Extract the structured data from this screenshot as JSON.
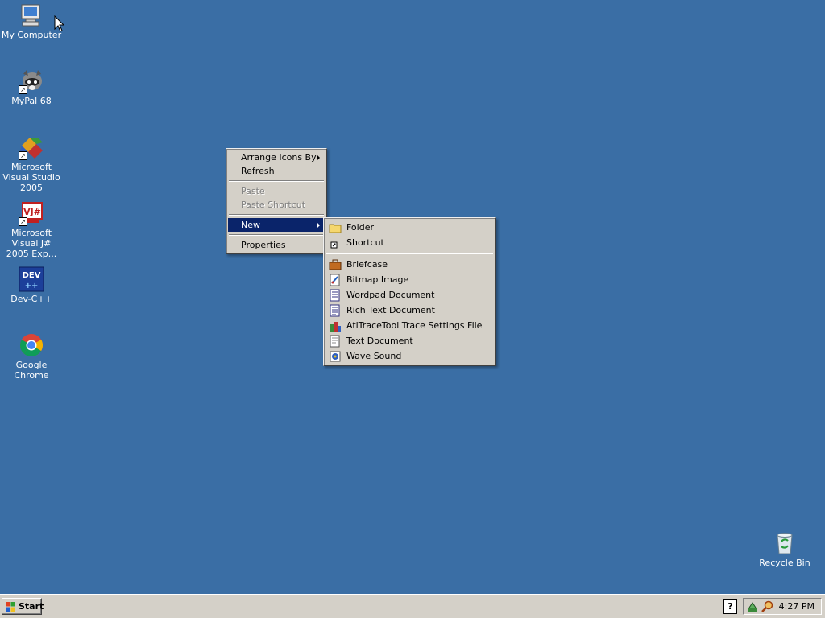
{
  "desktop": {
    "background_color": "#3a6ea5",
    "icons": [
      {
        "label": "My Computer",
        "icon": "computer-icon"
      },
      {
        "label": "MyPal 68",
        "icon": "raccoon-icon"
      },
      {
        "label": "Microsoft Visual Studio 2005",
        "icon": "visual-studio-icon"
      },
      {
        "label": "Microsoft Visual J# 2005 Exp...",
        "icon": "vjsharp-icon"
      },
      {
        "label": "Dev-C++",
        "icon": "devcpp-icon"
      },
      {
        "label": "Google Chrome",
        "icon": "chrome-icon"
      },
      {
        "label": "Recycle Bin",
        "icon": "recycle-bin-icon"
      }
    ]
  },
  "context_menu": {
    "arrange_icons_by": "Arrange Icons By",
    "refresh": "Refresh",
    "paste": "Paste",
    "paste_shortcut": "Paste Shortcut",
    "new": "New",
    "properties": "Properties"
  },
  "new_submenu": {
    "folder": "Folder",
    "shortcut": "Shortcut",
    "briefcase": "Briefcase",
    "bitmap_image": "Bitmap Image",
    "wordpad_document": "Wordpad Document",
    "rich_text_document": "Rich Text Document",
    "atltrace_settings": "AtlTraceTool Trace Settings File",
    "text_document": "Text Document",
    "wave_sound": "Wave Sound"
  },
  "taskbar": {
    "start_label": "Start",
    "help_label": "?",
    "clock": "4:27 PM"
  },
  "colors": {
    "menu_bg": "#d4d0c8",
    "highlight": "#0a246a"
  }
}
